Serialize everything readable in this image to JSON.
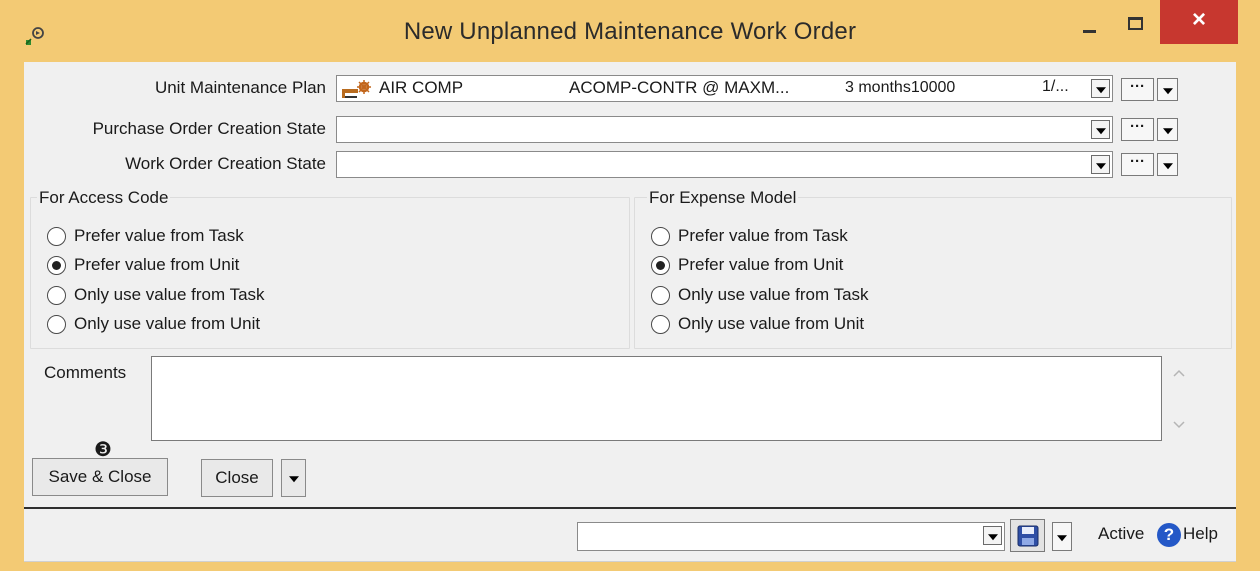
{
  "window": {
    "title": "New Unplanned Maintenance Work Order",
    "controls": {
      "minimize": "minimize-icon",
      "maximize": "maximize-icon",
      "close": "×"
    }
  },
  "form": {
    "unit_maintenance_plan": {
      "label": "Unit Maintenance Plan",
      "value": {
        "unit": "AIR COMP",
        "plan": "ACOMP-CONTR @ MAXM...",
        "interval": "3 months10000",
        "extra": "1/..."
      }
    },
    "purchase_order_creation_state": {
      "label": "Purchase Order Creation State",
      "value": ""
    },
    "work_order_creation_state": {
      "label": "Work Order Creation State",
      "value": ""
    },
    "ellipsis_label": "···"
  },
  "access_code": {
    "title": "For Access Code",
    "options": [
      "Prefer value from Task",
      "Prefer value from Unit",
      "Only use value from Task",
      "Only use value from Unit"
    ],
    "selected": 1
  },
  "expense_model": {
    "title": "For Expense Model",
    "options": [
      "Prefer value from Task",
      "Prefer value from Unit",
      "Only use value from Task",
      "Only use value from Unit"
    ],
    "selected": 1
  },
  "comments": {
    "label": "Comments",
    "value": ""
  },
  "buttons": {
    "save_close": "Save & Close",
    "close": "Close",
    "annotation": "❸"
  },
  "status": {
    "active_label": "Active",
    "help_label": "Help",
    "help_icon": "?"
  }
}
